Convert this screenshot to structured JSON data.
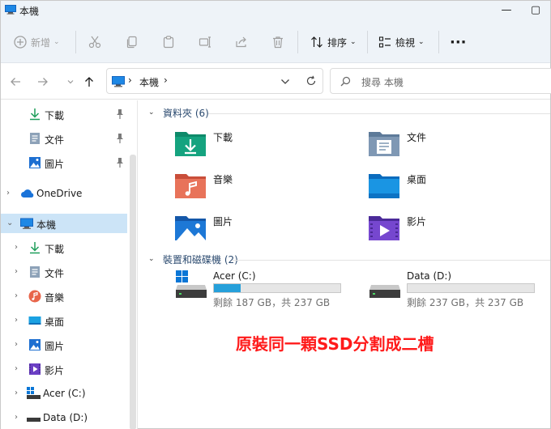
{
  "window": {
    "title": "本機",
    "minimize": "—",
    "maximize": "▢"
  },
  "commandbar": {
    "new_label": "新增",
    "sort_label": "排序",
    "view_label": "檢視",
    "more": "···",
    "chev": "⌄"
  },
  "address": {
    "path_root": "本機",
    "sep1": "›",
    "sep2": "›",
    "dropdown": "⌄"
  },
  "search": {
    "placeholder": "搜尋 本機"
  },
  "sidebar": {
    "quick_access": [
      {
        "label": "下載",
        "icon": "download-icon"
      },
      {
        "label": "文件",
        "icon": "documents-icon"
      },
      {
        "label": "圖片",
        "icon": "pictures-icon"
      }
    ],
    "onedrive": {
      "label": "OneDrive"
    },
    "thispc": {
      "label": "本機"
    },
    "thispc_children": [
      {
        "label": "下載",
        "icon": "download-icon"
      },
      {
        "label": "文件",
        "icon": "documents-icon"
      },
      {
        "label": "音樂",
        "icon": "music-icon"
      },
      {
        "label": "桌面",
        "icon": "desktop-icon"
      },
      {
        "label": "圖片",
        "icon": "pictures-icon"
      },
      {
        "label": "影片",
        "icon": "videos-icon"
      },
      {
        "label": "Acer (C:)",
        "icon": "drive-c-icon"
      },
      {
        "label": "Data (D:)",
        "icon": "drive-d-icon"
      }
    ]
  },
  "content": {
    "folders_group": "資料夾 (6)",
    "folders": [
      {
        "name": "下載",
        "icon": "download-folder-icon"
      },
      {
        "name": "文件",
        "icon": "documents-folder-icon"
      },
      {
        "name": "音樂",
        "icon": "music-folder-icon"
      },
      {
        "name": "桌面",
        "icon": "desktop-folder-icon"
      },
      {
        "name": "圖片",
        "icon": "pictures-folder-icon"
      },
      {
        "name": "影片",
        "icon": "videos-folder-icon"
      }
    ],
    "drives_group": "裝置和磁碟機 (2)",
    "drives": [
      {
        "name": "Acer (C:)",
        "free": "剩餘 187 GB，共 237 GB",
        "used_fraction": 0.21
      },
      {
        "name": "Data (D:)",
        "free": "剩餘 237 GB，共 237 GB",
        "used_fraction": 0.0
      }
    ]
  },
  "annotation": "原裝同一顆SSD分割成二槽",
  "colors": {
    "accent": "#0078d4",
    "selected": "#cce4f7",
    "annotation": "#ff1a1a"
  }
}
